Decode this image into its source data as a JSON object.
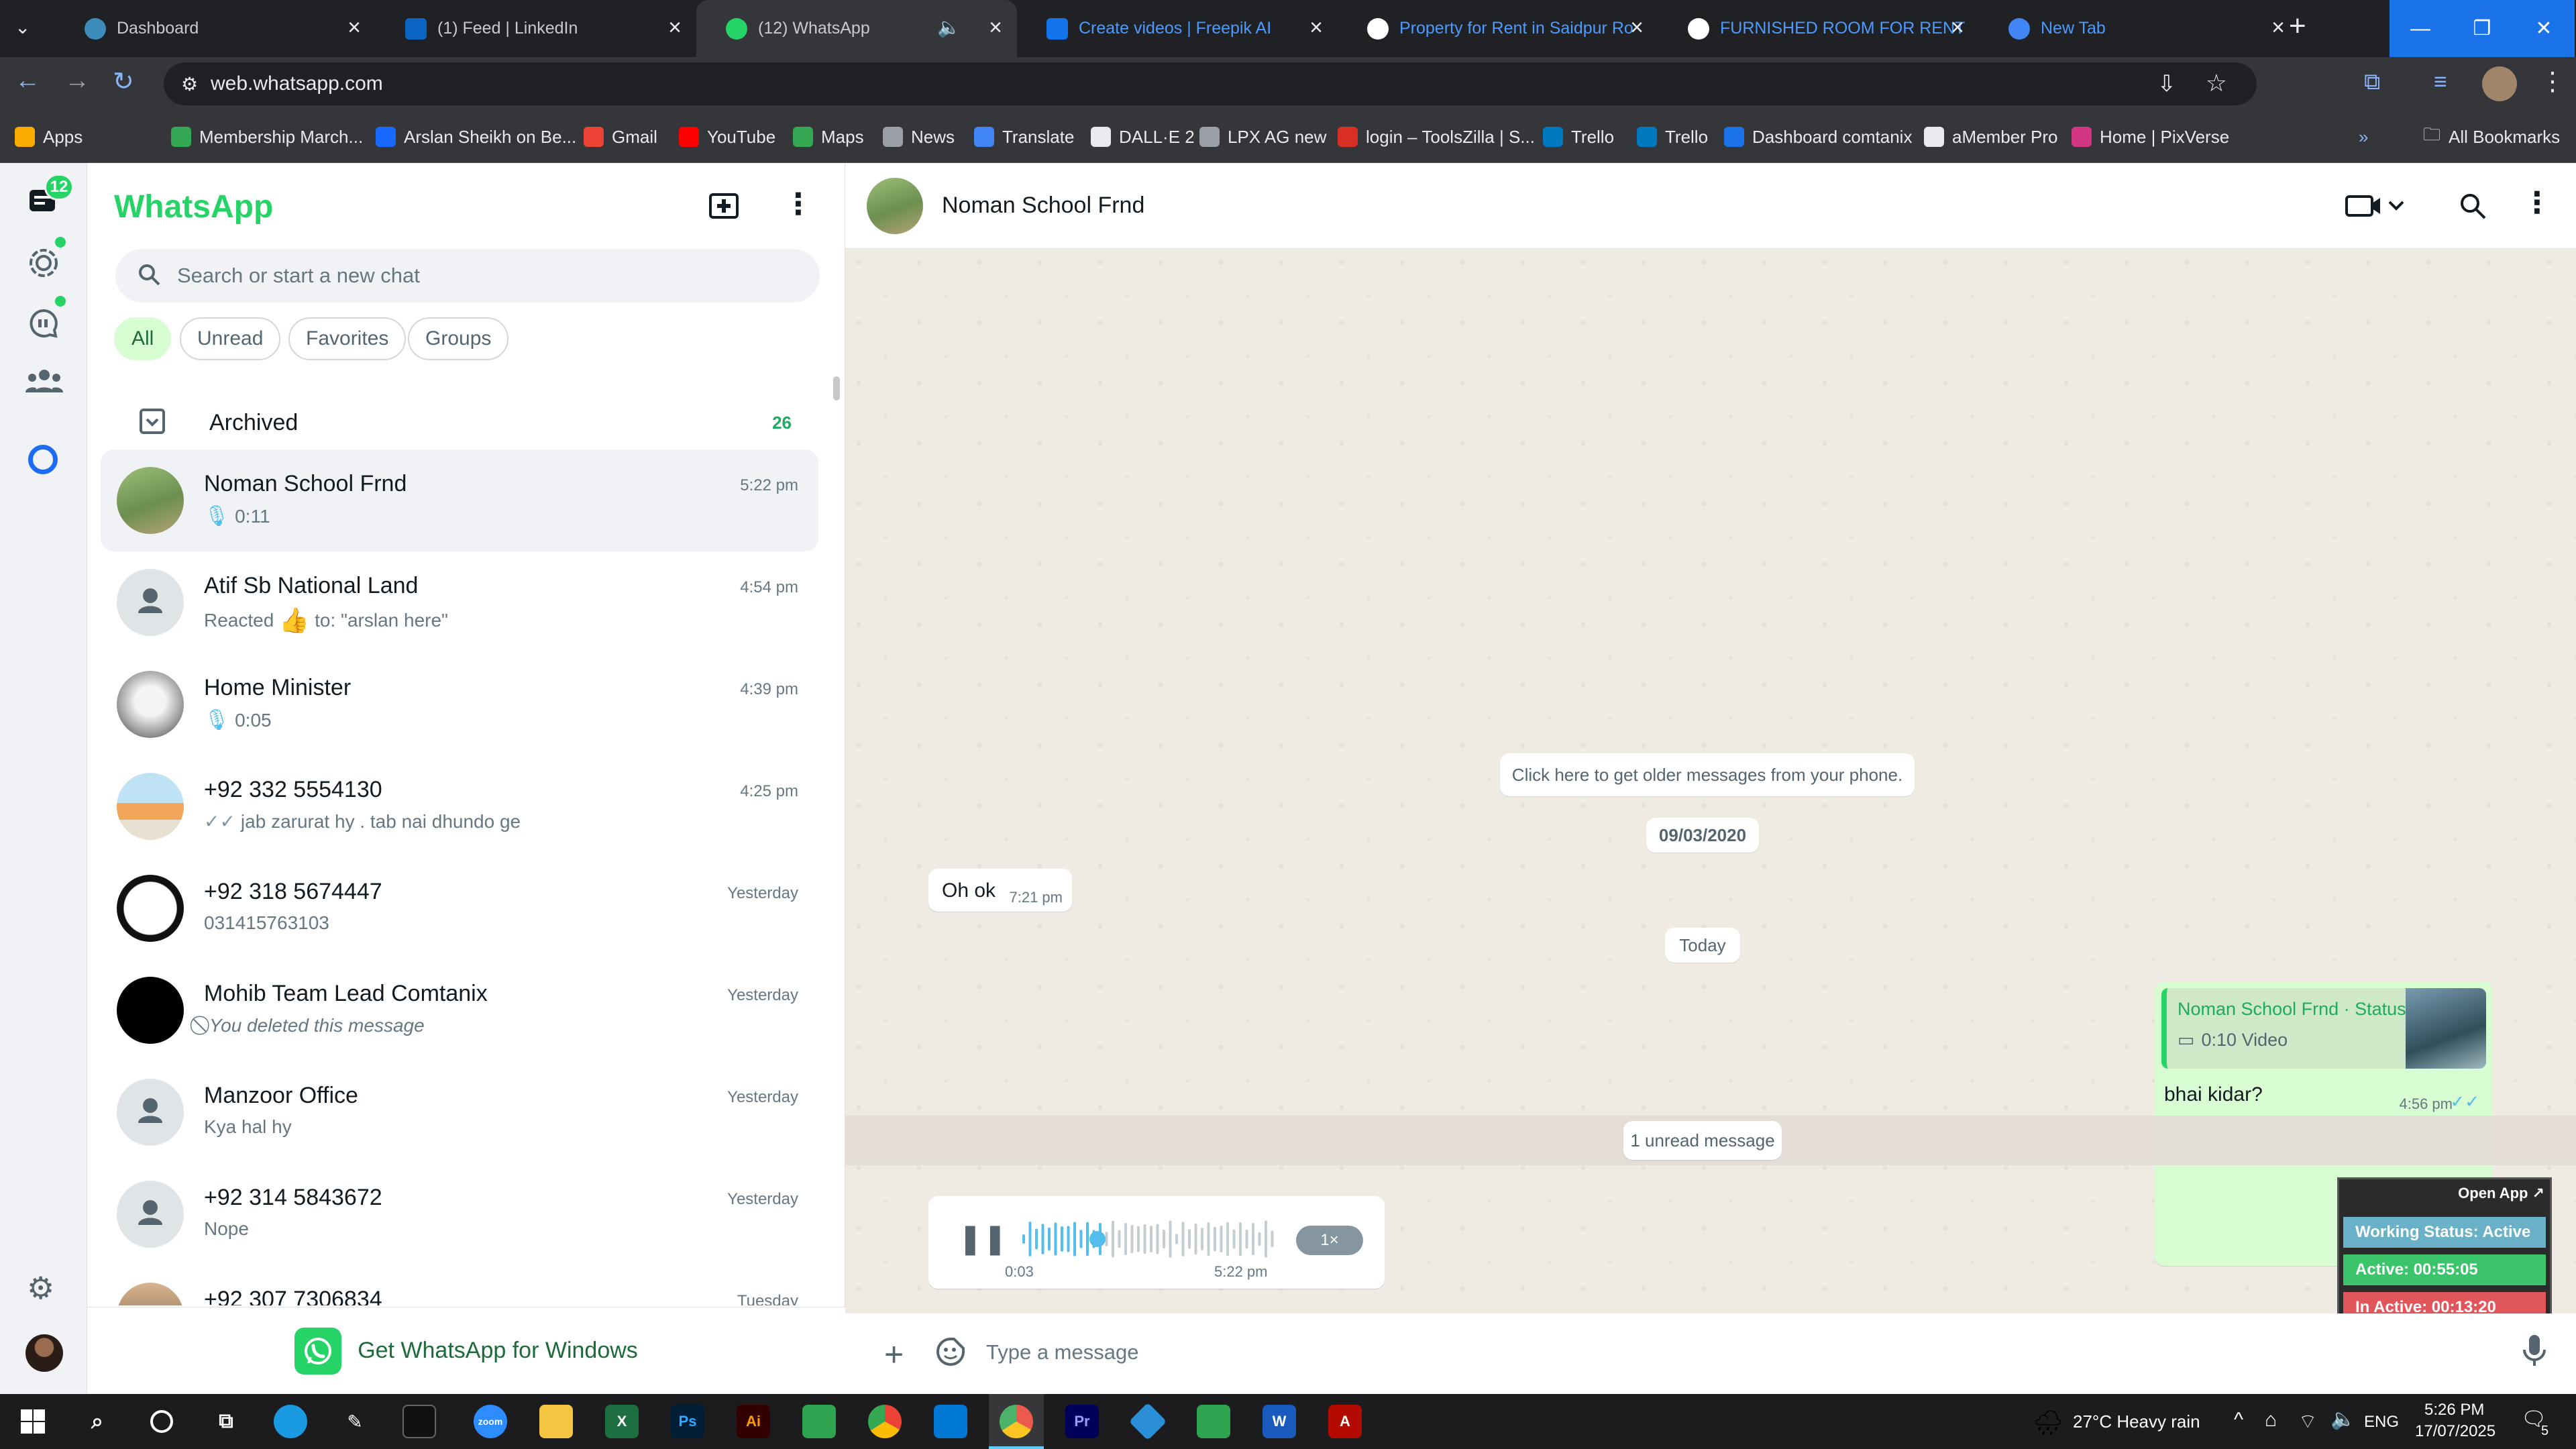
{
  "browser": {
    "tabs": [
      {
        "label": "Dashboard",
        "icon": "dashboard-favicon"
      },
      {
        "label": "(1) Feed | LinkedIn",
        "icon": "linkedin-icon"
      },
      {
        "label": "(12) WhatsApp",
        "icon": "whatsapp-icon"
      },
      {
        "label": "Create videos | Freepik AI",
        "icon": "freepik-icon"
      },
      {
        "label": "Property for Rent in Saidpur Ro",
        "icon": "property-icon"
      },
      {
        "label": "FURNISHED ROOM FOR RENT",
        "icon": "property-icon"
      },
      {
        "label": "New Tab",
        "icon": "chrome-icon"
      }
    ],
    "url": "web.whatsapp.com",
    "bookmarks": [
      {
        "label": "Apps",
        "color": "#f9ab00"
      },
      {
        "label": "Membership March...",
        "color": "#34a853"
      },
      {
        "label": "Arslan Sheikh on Be...",
        "color": "#1769ff"
      },
      {
        "label": "Gmail",
        "color": "#ea4335"
      },
      {
        "label": "YouTube",
        "color": "#ff0000"
      },
      {
        "label": "Maps",
        "color": "#34a853"
      },
      {
        "label": "News",
        "color": "#9aa0a6"
      },
      {
        "label": "Translate",
        "color": "#4285f4"
      },
      {
        "label": "DALL·E 2",
        "color": "#e8eaed"
      },
      {
        "label": "LPX AG new",
        "color": "#9aa0a6"
      },
      {
        "label": "login – ToolsZilla | S...",
        "color": "#d93025"
      },
      {
        "label": "Trello",
        "color": "#0079bf"
      },
      {
        "label": "Trello",
        "color": "#0079bf"
      },
      {
        "label": "Dashboard comtanix",
        "color": "#1a73e8"
      },
      {
        "label": "aMember Pro",
        "color": "#e8eaed"
      },
      {
        "label": "Home | PixVerse",
        "color": "#d33682"
      }
    ],
    "all_bookmarks": "All Bookmarks"
  },
  "rail": {
    "unread_badge": "12"
  },
  "sidebar": {
    "title": "WhatsApp",
    "search_placeholder": "Search or start a new chat",
    "filters": [
      "All",
      "Unread",
      "Favorites",
      "Groups"
    ],
    "archived": {
      "label": "Archived",
      "count": "26"
    },
    "chats": [
      {
        "name": "Noman School Frnd",
        "preview": "0:11",
        "time": "5:22 pm",
        "kind": "voice"
      },
      {
        "name": "Atif Sb National Land",
        "preview_a": "Reacted",
        "preview_b": "to: \"arslan here\"",
        "time": "4:54 pm",
        "kind": "reaction"
      },
      {
        "name": "Home Minister",
        "preview": "0:05",
        "time": "4:39 pm",
        "kind": "voice"
      },
      {
        "name": "+92 332 5554130",
        "preview": "jab zarurat hy . tab nai dhundo ge",
        "time": "4:25 pm",
        "kind": "read"
      },
      {
        "name": "+92 318 5674447",
        "preview": "031415763103",
        "time": "Yesterday",
        "kind": "text"
      },
      {
        "name": "Mohib Team Lead Comtanix",
        "preview": "You deleted this message",
        "time": "Yesterday",
        "kind": "deleted"
      },
      {
        "name": "Manzoor Office",
        "preview": "Kya hal hy",
        "time": "Yesterday",
        "kind": "text"
      },
      {
        "name": "+92 314 5843672",
        "preview": "Nope",
        "time": "Yesterday",
        "kind": "text"
      },
      {
        "name": "+92 307 7306834",
        "preview": "",
        "time": "Tuesday",
        "kind": "text"
      }
    ],
    "get_app": "Get WhatsApp for Windows"
  },
  "conversation": {
    "contact": "Noman School Frnd",
    "older_messages": "Click here to get older messages from your phone.",
    "date1": "09/03/2020",
    "msg1": {
      "text": "Oh ok",
      "time": "7:21 pm"
    },
    "date2": "Today",
    "reply": {
      "quote_title": "Noman School Frnd · Status",
      "quote_body": "0:10 Video",
      "text": "bhai kidar?",
      "time": "4:56 pm"
    },
    "unread_banner": "1 unread message",
    "voice": {
      "elapsed": "0:03",
      "time": "5:22 pm",
      "speed": "1×",
      "progress": 0.3
    },
    "composer_placeholder": "Type a message"
  },
  "overlay": {
    "open_app": "Open App ↗",
    "working": "Working Status: Active",
    "active": "Active: 00:55:05",
    "inactive": "In Active: 00:13:20"
  },
  "taskbar": {
    "weather": "27°C  Heavy rain",
    "lang": "ENG",
    "time": "5:26 PM",
    "date": "17/07/2025",
    "notif": "5"
  }
}
